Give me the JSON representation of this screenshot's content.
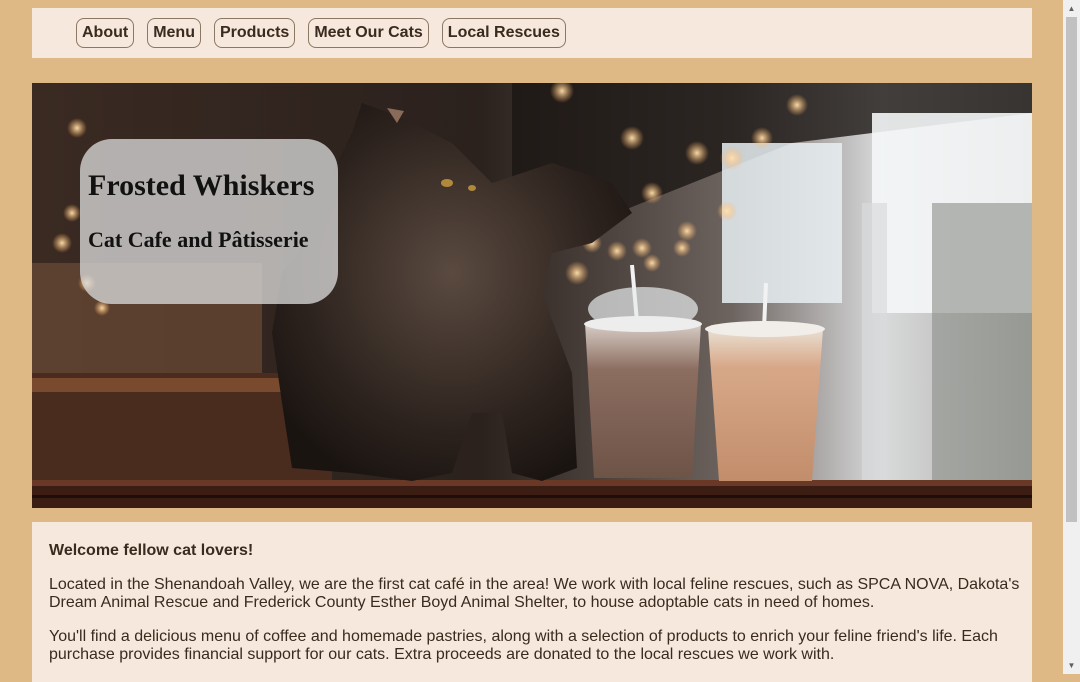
{
  "nav": {
    "items": [
      {
        "label": "About"
      },
      {
        "label": "Menu"
      },
      {
        "label": "Products"
      },
      {
        "label": "Meet Our Cats"
      },
      {
        "label": "Local Rescues"
      }
    ]
  },
  "hero": {
    "title": "Frosted Whiskers",
    "subtitle": "Cat Cafe and Pâtisserie"
  },
  "content": {
    "welcome": "Welcome fellow cat lovers!",
    "paragraph1": "Located in the Shenandoah Valley, we are the first cat café in the area! We work with local feline rescues, such as SPCA NOVA, Dakota's Dream Animal Rescue and Frederick County Esther Boyd Animal Shelter, to house adoptable cats in need of homes.",
    "paragraph2": "You'll find a delicious menu of coffee and homemade pastries, along with a selection of products to enrich your feline friend's life. Each purchase provides financial support for our cats. Extra proceeds are donated to the local rescues we work with."
  },
  "colors": {
    "page_background": "#dfb985",
    "panel_background": "#f6e8dc",
    "text": "#3b2a1e"
  },
  "icons": {
    "scroll_up": "triangle-up-icon",
    "scroll_down": "triangle-down-icon"
  }
}
